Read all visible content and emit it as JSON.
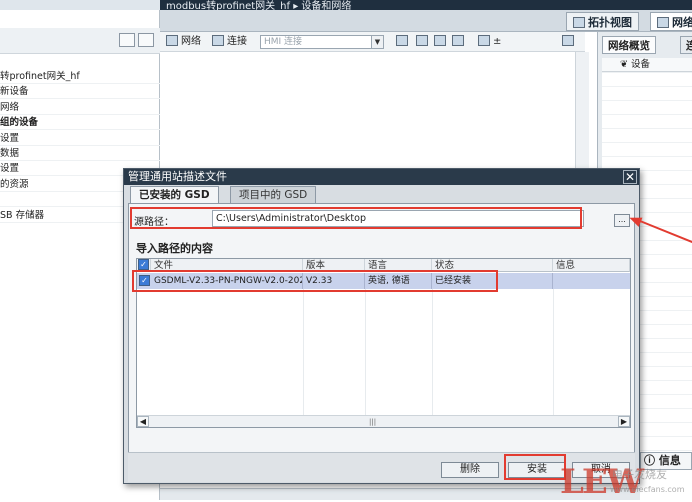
{
  "window": {
    "breadcrumb": "modbus转profinet网关_hf  ▸  设备和网络"
  },
  "project_tree": {
    "items": [
      {
        "label": "转profinet网关_hf",
        "bold": false
      },
      {
        "label": "新设备",
        "bold": false
      },
      {
        "label": "网络",
        "bold": false
      },
      {
        "label": "组的设备",
        "bold": true
      },
      {
        "label": "设置",
        "bold": false
      },
      {
        "label": "数据",
        "bold": false
      },
      {
        "label": "设置",
        "bold": false
      },
      {
        "label": "的资源",
        "bold": false
      },
      {
        "label": "",
        "bold": false
      },
      {
        "label": "SB 存储器",
        "bold": false
      }
    ]
  },
  "view_tabs": {
    "topology": "拓扑视图",
    "network": "网络"
  },
  "editor_toolbar": {
    "network_btn": "网络",
    "connection_btn": "连接",
    "hmi_select": "HMI 连接"
  },
  "overview_panel": {
    "tab_overview": "网络概览",
    "tab_other": "连",
    "col_device": "设备"
  },
  "info_tab": "信息",
  "dialog": {
    "title": "管理通用站描述文件",
    "tabs": [
      "已安装的 GSD",
      "项目中的 GSD"
    ],
    "source_label": "源路径：",
    "source_path": "C:\\Users\\Administrator\\Desktop",
    "browse_label": "...",
    "section_title": "导入路径的内容",
    "columns": [
      "文件",
      "版本",
      "语言",
      "状态",
      "信息"
    ],
    "rows": [
      {
        "file": "GSDML-V2.33-PN-PNGW-V2.0-202...",
        "version": "V2.33",
        "language": "英语, 德语",
        "status": "已经安装",
        "info": "",
        "checked": true
      }
    ],
    "buttons": {
      "delete": "删除",
      "install": "安装",
      "cancel": "取消"
    }
  },
  "colors": {
    "accent_red": "#e23b30",
    "selected_row": "#c8d2ec",
    "title_bar": "#2a3a4a"
  },
  "watermark": {
    "mark": "LEW",
    "subtitle": "电子发烧友",
    "url": "www.elecfans.com"
  }
}
